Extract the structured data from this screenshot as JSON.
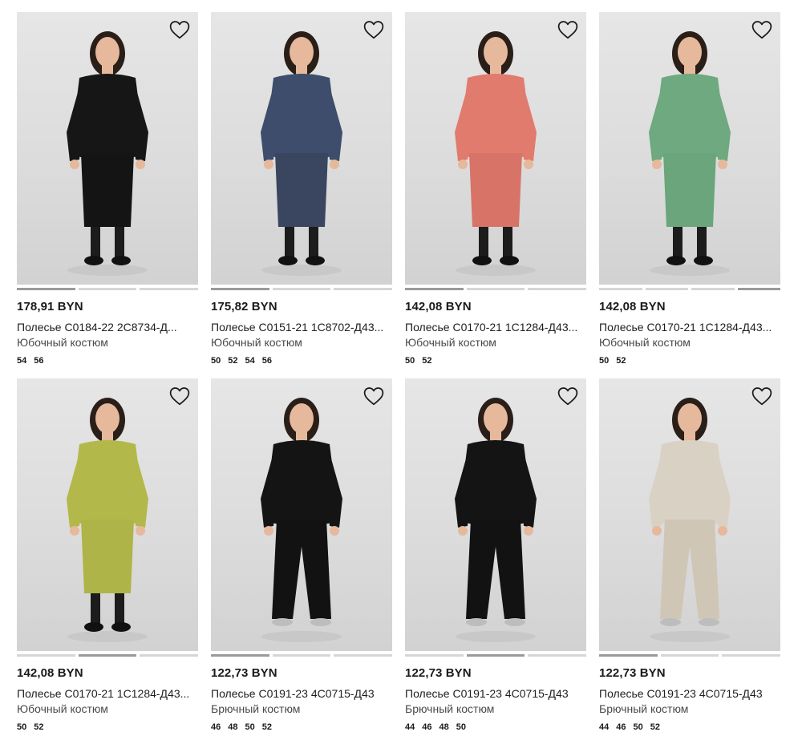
{
  "products": [
    {
      "price": "178,91 BYN",
      "name": "Полесье С0184-22 2С8734-Д...",
      "category": "Юбочный костюм",
      "sizes": [
        "54",
        "56"
      ],
      "slides": [
        1,
        0,
        0
      ],
      "top_color": "#161616",
      "bottom_color": "#141414",
      "icon": "heart-outline-icon"
    },
    {
      "price": "175,82 BYN",
      "name": "Полесье С0151-21 1С8702-Д43...",
      "category": "Юбочный костюм",
      "sizes": [
        "50",
        "52",
        "54",
        "56"
      ],
      "slides": [
        1,
        0,
        0
      ],
      "top_color": "#3d4d6b",
      "bottom_color": "#3a4660",
      "icon": "heart-outline-icon"
    },
    {
      "price": "142,08 BYN",
      "name": "Полесье С0170-21 1С1284-Д43...",
      "category": "Юбочный костюм",
      "sizes": [
        "50",
        "52"
      ],
      "slides": [
        1,
        0,
        0
      ],
      "top_color": "#e07b6e",
      "bottom_color": "#d87467",
      "icon": "heart-outline-icon"
    },
    {
      "price": "142,08 BYN",
      "name": "Полесье С0170-21 1С1284-Д43...",
      "category": "Юбочный костюм",
      "sizes": [
        "50",
        "52"
      ],
      "slides": [
        0,
        0,
        0,
        1
      ],
      "top_color": "#6ea97f",
      "bottom_color": "#6aa57b",
      "icon": "heart-outline-icon"
    },
    {
      "price": "142,08 BYN",
      "name": "Полесье С0170-21 1С1284-Д43...",
      "category": "Юбочный костюм",
      "sizes": [
        "50",
        "52"
      ],
      "slides": [
        0,
        1,
        0
      ],
      "top_color": "#b3b84a",
      "bottom_color": "#aeb447",
      "icon": "heart-outline-icon"
    },
    {
      "price": "122,73 BYN",
      "name": "Полесье С0191-23 4С0715-Д43",
      "category": "Брючный костюм",
      "sizes": [
        "46",
        "48",
        "50",
        "52"
      ],
      "slides": [
        1,
        0,
        0
      ],
      "top_color": "#141414",
      "bottom_color": "#121212",
      "icon": "heart-outline-icon"
    },
    {
      "price": "122,73 BYN",
      "name": "Полесье С0191-23 4С0715-Д43",
      "category": "Брючный костюм",
      "sizes": [
        "44",
        "46",
        "48",
        "50"
      ],
      "slides": [
        0,
        1,
        0
      ],
      "top_color": "#141414",
      "bottom_color": "#121212",
      "icon": "heart-outline-icon"
    },
    {
      "price": "122,73 BYN",
      "name": "Полесье С0191-23 4С0715-Д43",
      "category": "Брючный костюм",
      "sizes": [
        "44",
        "46",
        "50",
        "52"
      ],
      "slides": [
        1,
        0,
        0
      ],
      "top_color": "#d9d2c4",
      "bottom_color": "#cfc6b6",
      "icon": "heart-outline-icon"
    }
  ]
}
